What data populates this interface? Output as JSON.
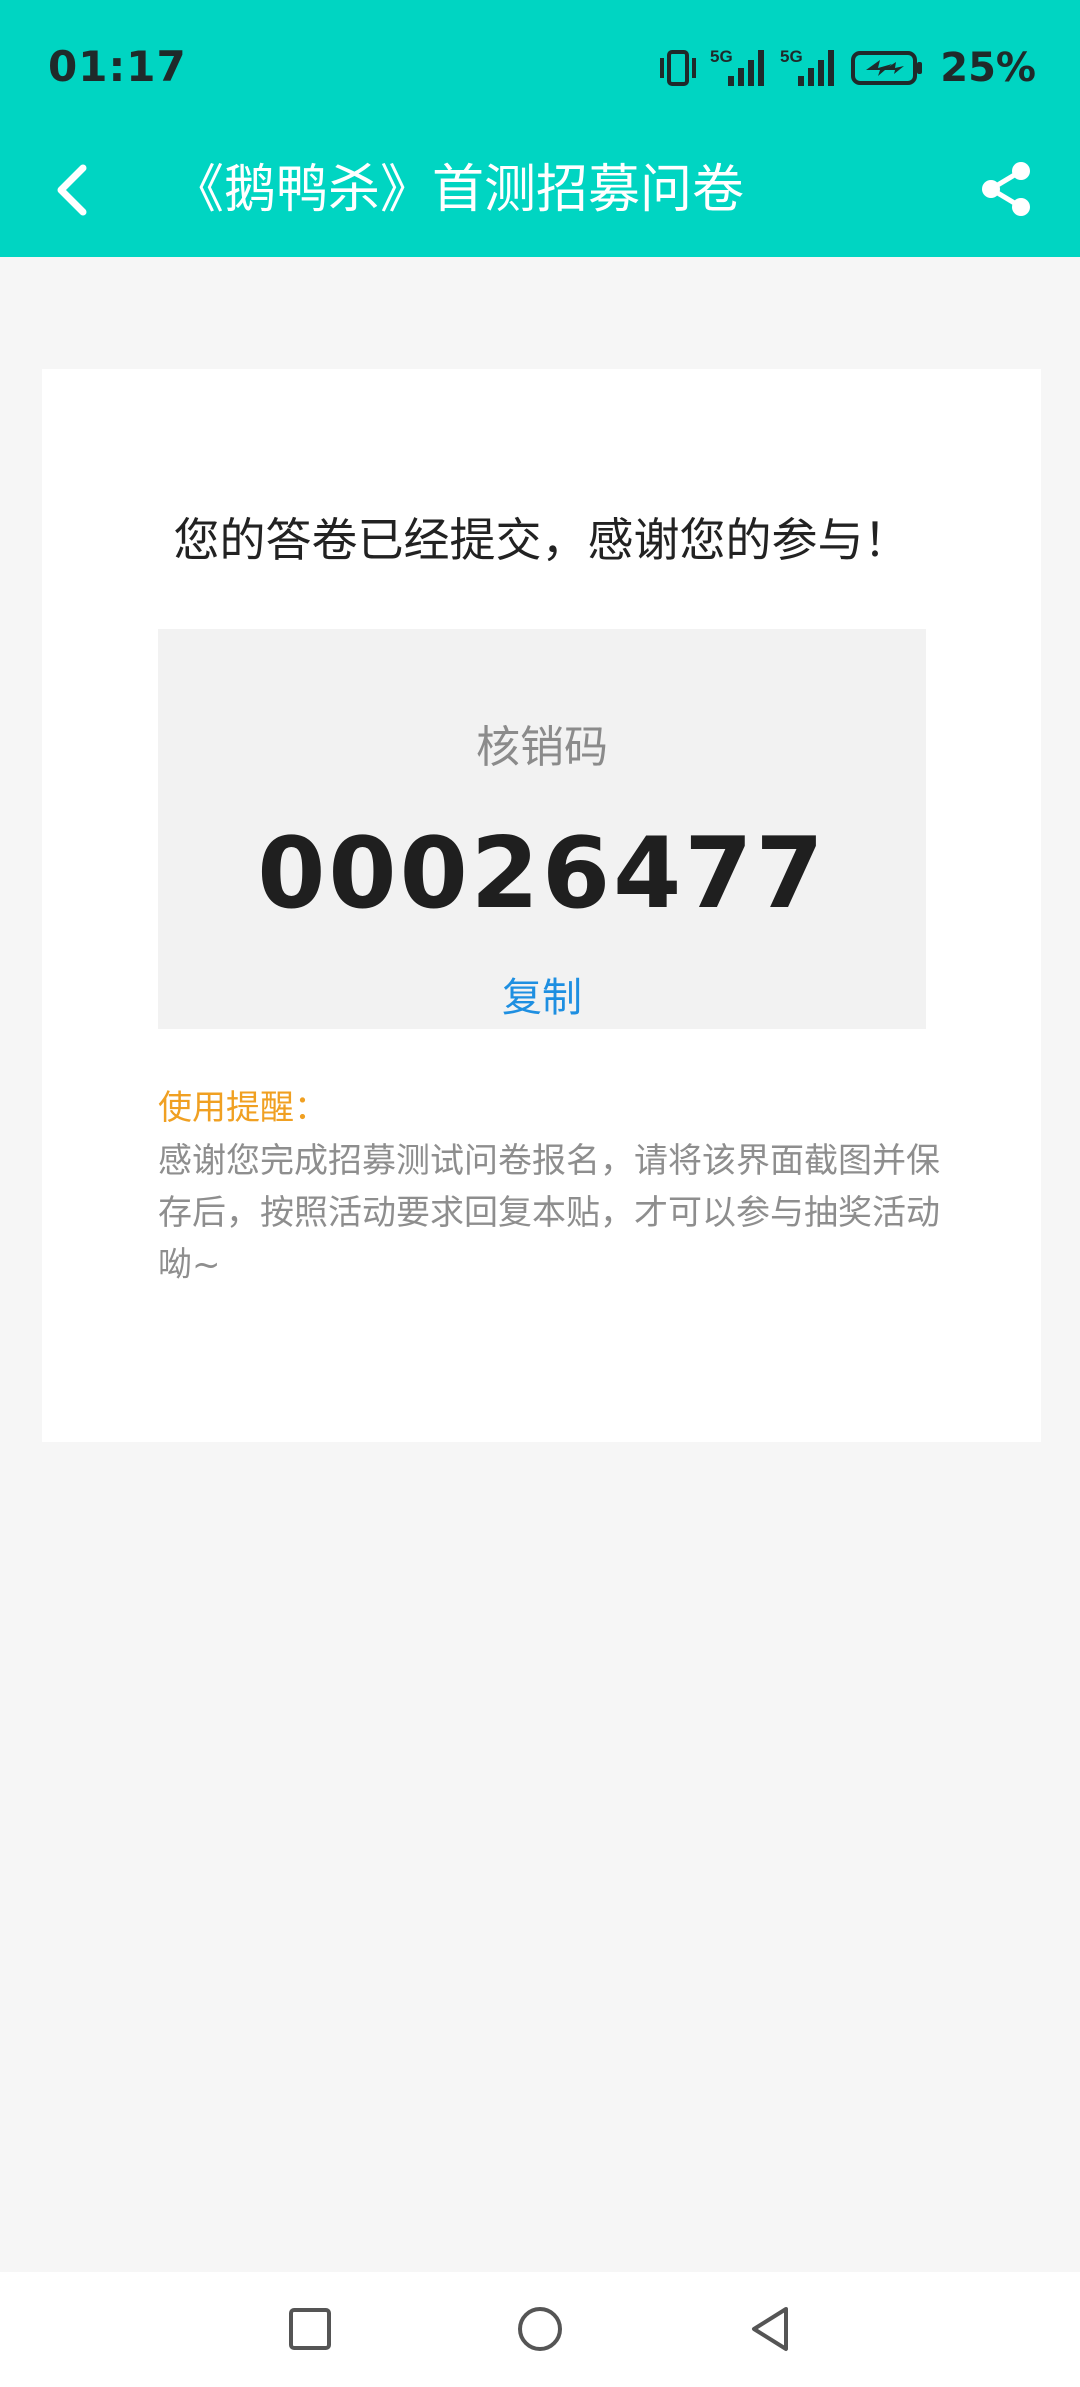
{
  "status_bar": {
    "time": "01:17",
    "battery_percent": "25%",
    "icons": [
      "vibrate-icon",
      "signal-5g-icon",
      "signal-5g-icon",
      "battery-charging-icon"
    ],
    "network_label_1": "5G",
    "network_label_2": "5G"
  },
  "app_bar": {
    "title": "《鹅鸭杀》首测招募问卷",
    "back_icon": "chevron-left-icon",
    "share_icon": "share-icon"
  },
  "result": {
    "message": "您的答卷已经提交，感谢您的参与！",
    "code_label": "核销码",
    "code_value": "00026477",
    "copy_label": "复制"
  },
  "tip": {
    "title": "使用提醒：",
    "body": "感谢您完成招募测试问卷报名，请将该界面截图并保存后，按照活动要求回复本贴，才可以参与抽奖活动呦~"
  },
  "nav_bar": {
    "icons": [
      "square-recent-icon",
      "circle-home-icon",
      "triangle-back-icon"
    ]
  },
  "colors": {
    "accent": "#00d5c2",
    "link": "#1e8fe1",
    "tip_title": "#f0a022",
    "background": "#f6f6f6"
  }
}
